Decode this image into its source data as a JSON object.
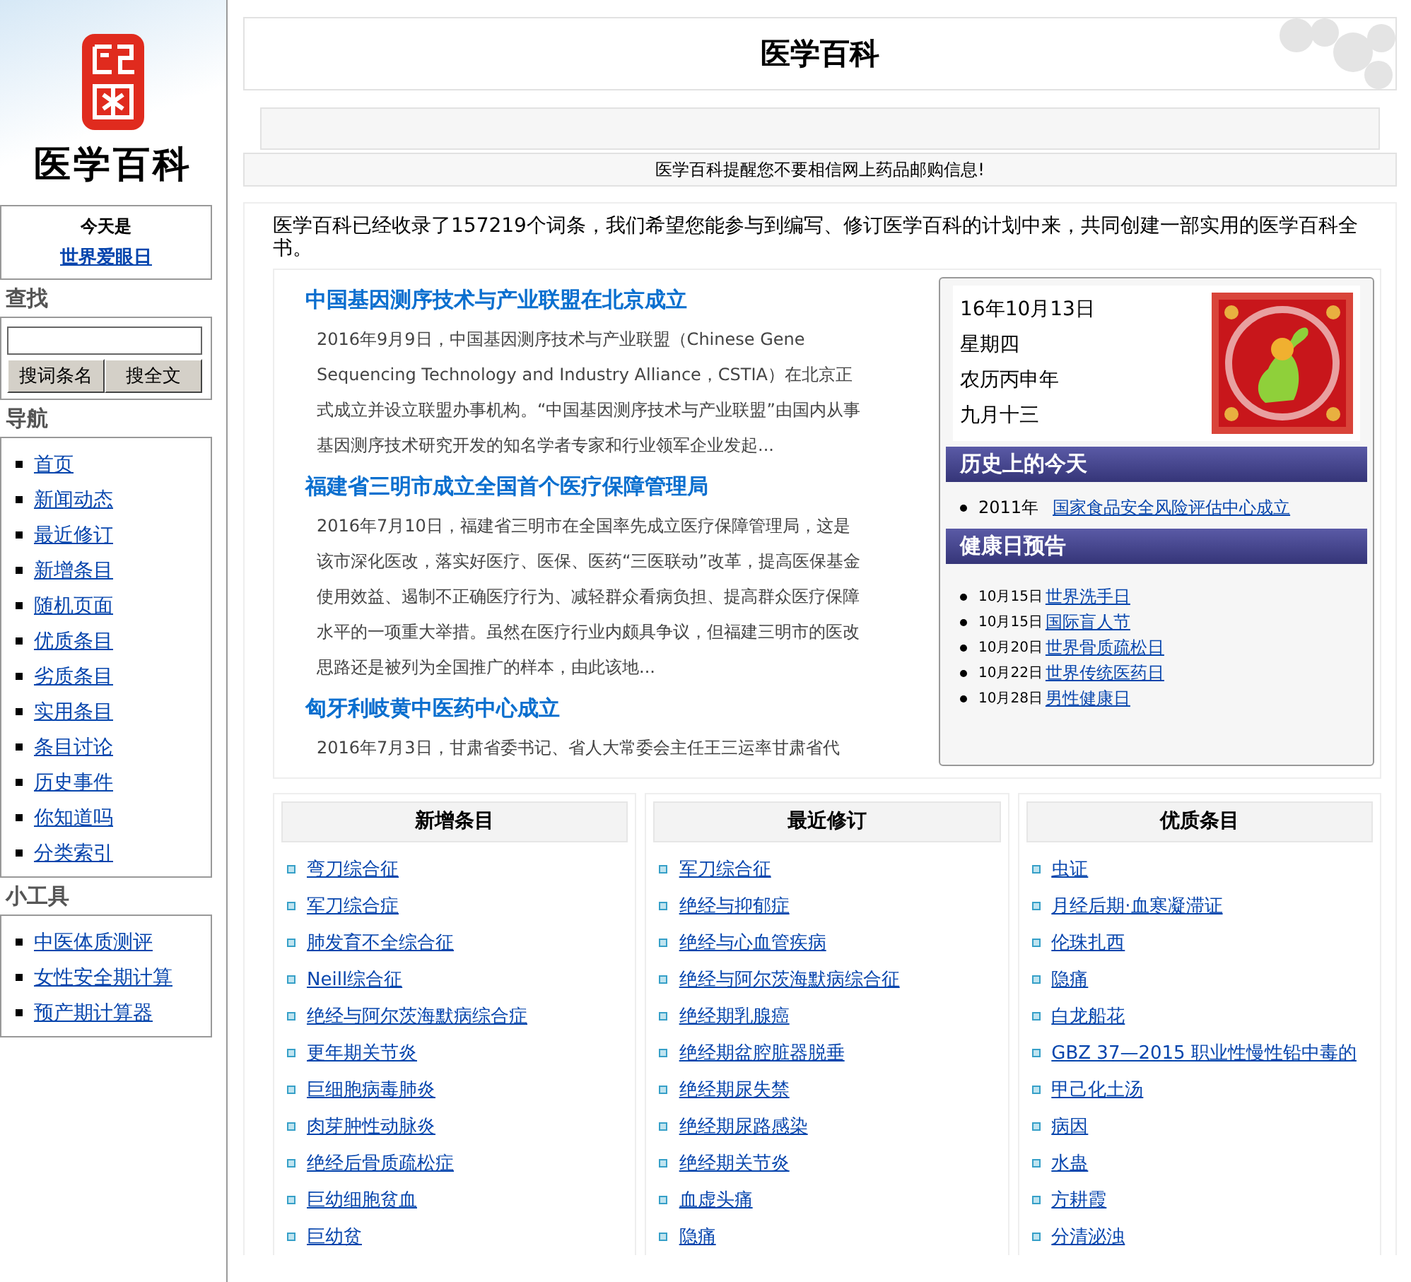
{
  "sidebar": {
    "logo_text": "医学百科",
    "today": {
      "label": "今天是",
      "link": "世界爱眼日"
    },
    "search": {
      "heading": "查找",
      "buttons": [
        "搜词条名",
        "搜全文"
      ]
    },
    "navigation": {
      "heading": "导航",
      "items": [
        "首页",
        "新闻动态",
        "最近修订",
        "新增条目",
        "随机页面",
        "优质条目",
        "劣质条目",
        "实用条目",
        "条目讨论",
        "历史事件",
        "你知道吗",
        "分类索引"
      ]
    },
    "tools": {
      "heading": "小工具",
      "items": [
        "中医体质测评",
        "女性安全期计算",
        "预产期计算器"
      ]
    }
  },
  "header": {
    "title": "医学百科"
  },
  "notice": "医学百科提醒您不要相信网上药品邮购信息!",
  "intro": "医学百科已经收录了157219个词条，我们希望您能参与到编写、修订医学百科的计划中来，共同创建一部实用的医学百科全书。",
  "news": [
    {
      "title": "中国基因测序技术与产业联盟在北京成立",
      "summary": "2016年9月9日，中国基因测序技术与产业联盟（Chinese Gene Sequencing Technology and Industry Alliance，CSTIA）在北京正式成立并设立联盟办事机构。“中国基因测序技术与产业联盟”由国内从事基因测序技术研究开发的知名学者专家和行业领军企业发起..."
    },
    {
      "title": "福建省三明市成立全国首个医疗保障管理局",
      "summary": "2016年7月10日，福建省三明市在全国率先成立医疗保障管理局，这是该市深化医改，落实好医疗、医保、医药“三医联动”改革，提高医保基金使用效益、遏制不正确医疗行为、减轻群众看病负担、提高群众医疗保障水平的一项重大举措。虽然在医疗行业内颇具争议，但福建三明市的医改思路还是被列为全国推广的样本，由此该地..."
    },
    {
      "title": "匈牙利岐黄中医药中心成立",
      "summary": "2016年7月3日，甘肃省委书记、省人大常委会主任王三运率甘肃省代"
    }
  ],
  "calendar": {
    "date_lines": [
      "16年10月13日",
      "星期四",
      "农历丙申年",
      "九月十三"
    ],
    "history": {
      "heading": "历史上的今天",
      "items": [
        {
          "year": "2011年",
          "event": "国家食品安全风险评估中心成立"
        }
      ]
    },
    "health_days": {
      "heading": "健康日预告",
      "items": [
        {
          "date": "10月15日",
          "name": "世界洗手日"
        },
        {
          "date": "10月15日",
          "name": "国际盲人节"
        },
        {
          "date": "10月20日",
          "name": "世界骨质疏松日"
        },
        {
          "date": "10月22日",
          "name": "世界传统医药日"
        },
        {
          "date": "10月28日",
          "name": "男性健康日"
        }
      ]
    }
  },
  "columns": [
    {
      "heading": "新增条目",
      "items": [
        "弯刀综合征",
        "军刀综合症",
        "肺发育不全综合征",
        "Neill综合征",
        "绝经与阿尔茨海默病综合症",
        "更年期关节炎",
        "巨细胞病毒肺炎",
        "肉芽肿性动脉炎",
        "绝经后骨质疏松症",
        "巨幼细胞贫血",
        "巨幼贫"
      ]
    },
    {
      "heading": "最近修订",
      "items": [
        "军刀综合征",
        "绝经与抑郁症",
        "绝经与心血管疾病",
        "绝经与阿尔茨海默病综合征",
        "绝经期乳腺癌",
        "绝经期盆腔脏器脱垂",
        "绝经期尿失禁",
        "绝经期尿路感染",
        "绝经期关节炎",
        "血虚头痛",
        "隐痛"
      ]
    },
    {
      "heading": "优质条目",
      "items": [
        "虫证",
        "月经后期·血寒凝滞证",
        "伦珠扎西",
        "隐痛",
        "白龙船花",
        "GBZ 37—2015 职业性慢性铅中毒的",
        "甲己化土汤",
        "病因",
        "水蛊",
        "方耕霞",
        "分清泌浊"
      ]
    }
  ]
}
